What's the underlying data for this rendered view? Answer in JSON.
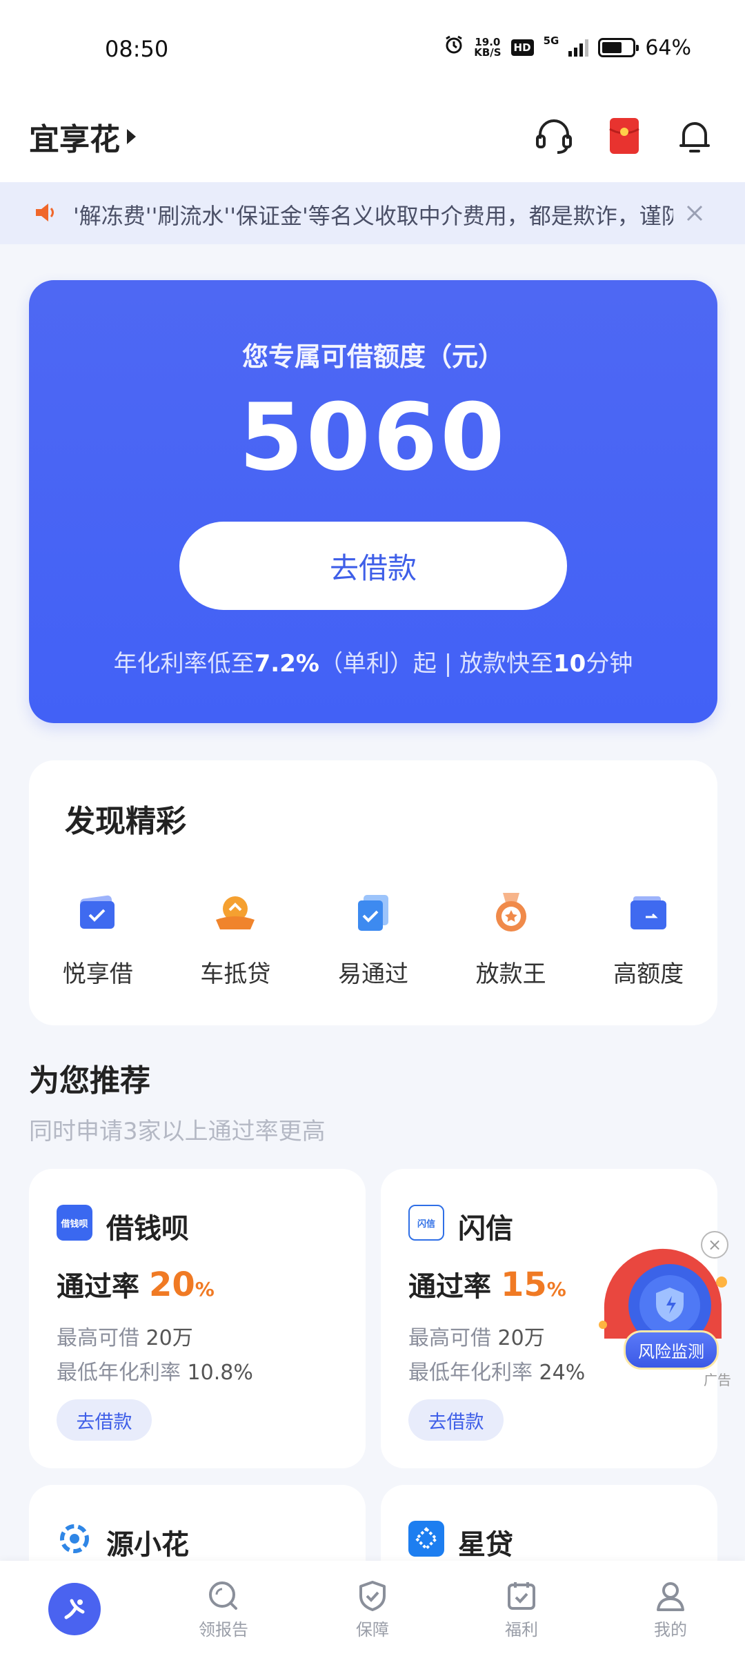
{
  "status_bar": {
    "time": "08:50",
    "net_speed_value": "19.0",
    "net_speed_unit": "KB/S",
    "hd_label": "HD",
    "network_label": "5G",
    "battery_text": "64%",
    "battery_level": 0.64
  },
  "header": {
    "app_name": "宜享花"
  },
  "notice": {
    "text": "'解冻费''刷流水''保证金'等名义收取中介费用，都是欺诈，谨防"
  },
  "credit_card": {
    "label": "您专属可借额度（元）",
    "amount": "5060",
    "button_label": "去借款",
    "note_prefix": "年化利率低至",
    "note_rate": "7.2%",
    "note_mid": "（单利）起 | 放款快至",
    "note_time": "10",
    "note_suffix": "分钟"
  },
  "discover": {
    "title": "发现精彩",
    "items": [
      {
        "label": "悦享借",
        "icon": "check-card-icon",
        "color": "#3f6af0"
      },
      {
        "label": "车抵贷",
        "icon": "car-loan-icon",
        "color": "#f5a030"
      },
      {
        "label": "易通过",
        "icon": "easy-pass-icon",
        "color": "#3d8af0"
      },
      {
        "label": "放款王",
        "icon": "medal-icon",
        "color": "#f08a4a"
      },
      {
        "label": "高额度",
        "icon": "wallet-icon",
        "color": "#3f6af0"
      }
    ]
  },
  "recommend": {
    "title": "为您推荐",
    "subtitle": "同时申请3家以上通过率更高",
    "rate_label": "通过率",
    "max_label": "最高可借",
    "min_rate_label": "最低年化利率",
    "button_label": "去借款",
    "cards": [
      {
        "name": "借钱呗",
        "logo_text": "借钱呗",
        "logo_color": "#3a68f0",
        "pass_rate": "20",
        "pass_unit": "%",
        "max_amount": "20万",
        "min_rate": "10.8%"
      },
      {
        "name": "闪信",
        "logo_text": "闪信",
        "logo_color": "#2f6fe6",
        "pass_rate": "15",
        "pass_unit": "%",
        "max_amount": "20万",
        "min_rate": "24%"
      },
      {
        "name": "源小花",
        "logo_text": "",
        "logo_color": "#2f86e6"
      },
      {
        "name": "星贷",
        "logo_text": "",
        "logo_color": "#1d7ef0"
      }
    ]
  },
  "risk_float": {
    "label": "风险监测",
    "ad_tag": "广告"
  },
  "tabbar": {
    "tabs": [
      {
        "label": "",
        "icon": "home-logo-icon"
      },
      {
        "label": "领报告",
        "icon": "report-icon"
      },
      {
        "label": "保障",
        "icon": "shield-check-icon"
      },
      {
        "label": "福利",
        "icon": "calendar-check-icon"
      },
      {
        "label": "我的",
        "icon": "user-icon"
      }
    ]
  },
  "colors": {
    "primary": "#4261f6",
    "accent_orange": "#f07a24",
    "notice_bg": "#e9edfb",
    "page_bg": "#f4f6fb"
  }
}
